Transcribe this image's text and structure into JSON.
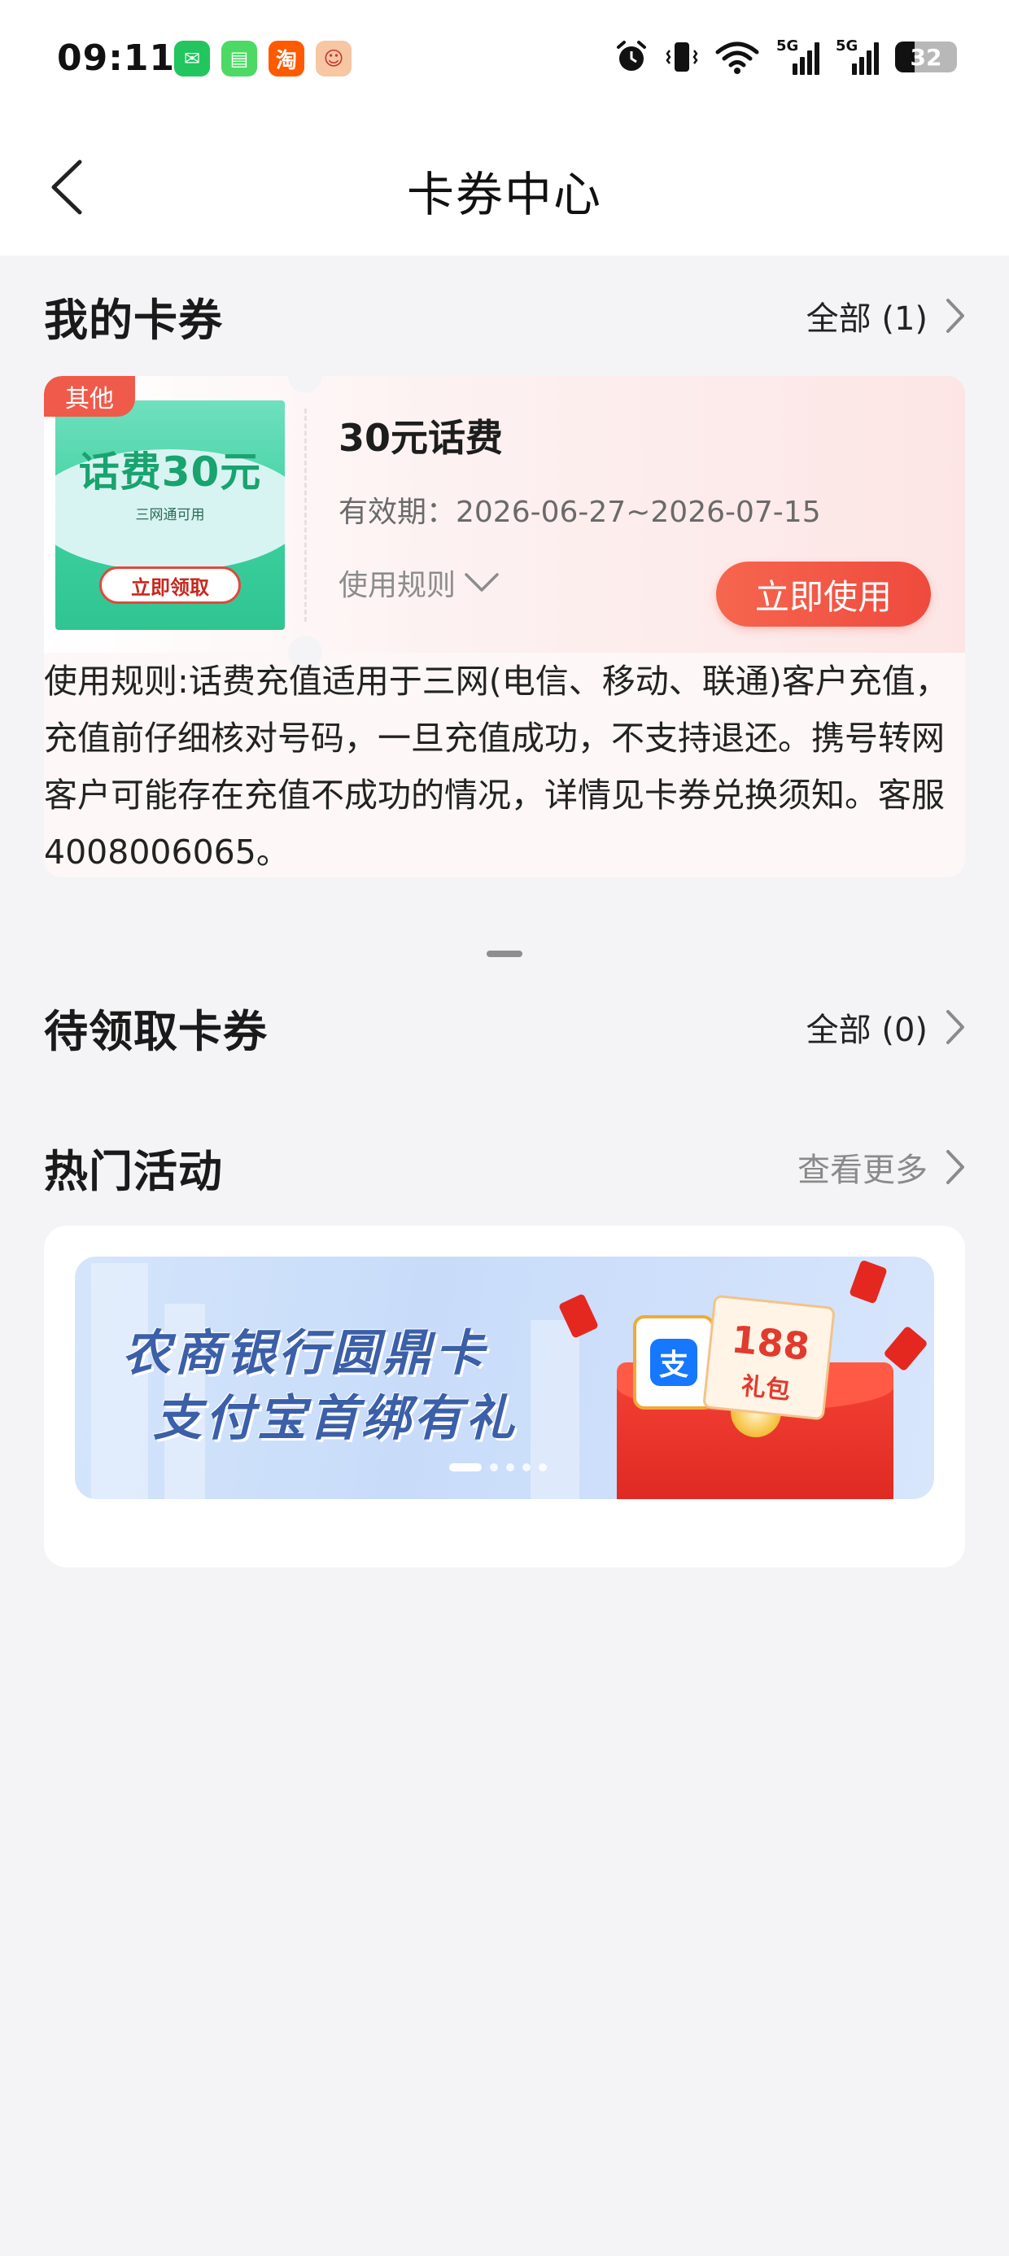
{
  "status_bar": {
    "time": "09:11",
    "apps": [
      {
        "name": "wechat-icon",
        "glyph": "✉",
        "color": "#22c55e"
      },
      {
        "name": "messages-icon",
        "glyph": "▤",
        "color": "#4cd964"
      },
      {
        "name": "taobao-icon",
        "glyph": "淘",
        "color": "#ff5a00"
      },
      {
        "name": "app-mascot-icon",
        "glyph": "☺",
        "color": "#f4b183"
      }
    ],
    "network_1": "5G",
    "network_2": "5G",
    "battery": "32"
  },
  "nav": {
    "title": "卡券中心"
  },
  "my_coupons": {
    "title": "我的卡券",
    "all_label": "全部 (1)",
    "coupon": {
      "tag": "其他",
      "image_amount": "话费30元",
      "image_subtitle": "三网通可用",
      "image_cta": "立即领取",
      "name": "30元话费",
      "validity": "有效期：2026-06-27~2026-07-15",
      "rules_toggle": "使用规则",
      "use_button": "立即使用",
      "rules_text": "使用规则:话费充值适用于三网(电信、移动、联通)客户充值，充值前仔细核对号码，一旦充值成功，不支持退还。携号转网客户可能存在充值不成功的情况，详情见卡券兑换须知。客服4008006065。"
    }
  },
  "pending_coupons": {
    "title": "待领取卡券",
    "all_label": "全部 (0)"
  },
  "hot_activities": {
    "title": "热门活动",
    "more_label": "查看更多",
    "banner": {
      "line1": "农商银行圆鼎卡",
      "line2": "支付宝首绑有礼",
      "gift_amount": "188",
      "gift_label": "礼包",
      "alipay_glyph": "支",
      "active_slide": 1,
      "slide_count": 5
    }
  },
  "colors": {
    "accent": "#ef4a3d",
    "tag": "#f05a4a",
    "page_bg": "#f4f4f6"
  }
}
